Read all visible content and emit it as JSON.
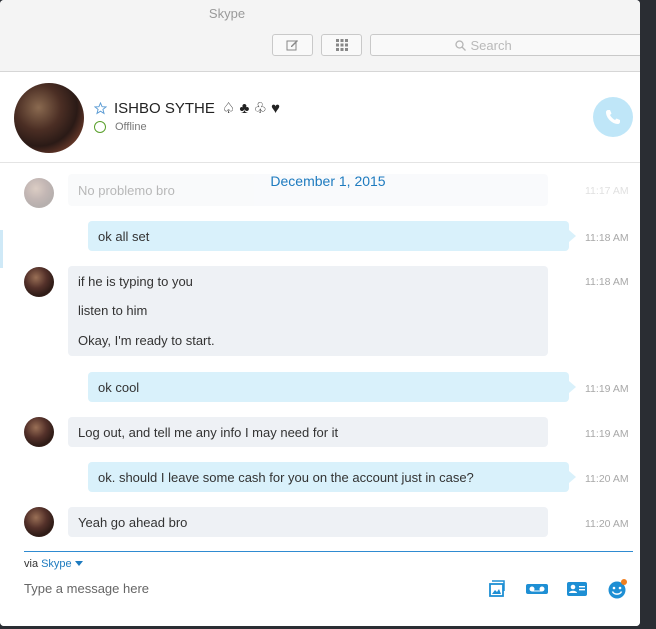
{
  "app": {
    "window_title": "Skype"
  },
  "toolbar": {
    "compose_icon": "compose-icon",
    "dialpad_icon": "dialpad-icon",
    "search_placeholder": "Search"
  },
  "contact": {
    "name": "ISHBO SYTHE",
    "suits": "♤ ♣ ♧ ♥",
    "status": "Offline",
    "colors": {
      "status": "#5aa02c",
      "call_button": "#bfe6f8"
    }
  },
  "conversation": {
    "date": "December 1, 2015",
    "messages": [
      {
        "direction": "in",
        "lines": [
          "No problemo bro"
        ],
        "time": "11:17 AM",
        "faded": true
      },
      {
        "direction": "out",
        "lines": [
          "ok all set"
        ],
        "time": "11:18 AM"
      },
      {
        "direction": "in",
        "lines": [
          "if he is typing to you",
          "listen to him",
          "Okay, I'm ready to start."
        ],
        "time": "11:18 AM"
      },
      {
        "direction": "out",
        "lines": [
          "ok cool"
        ],
        "time": "11:19 AM"
      },
      {
        "direction": "in",
        "lines": [
          "Log out, and tell me any info I may need for it"
        ],
        "time": "11:19 AM"
      },
      {
        "direction": "out",
        "lines": [
          "ok. should I leave some cash for you on the account just in case?"
        ],
        "time": "11:20 AM"
      },
      {
        "direction": "in",
        "lines": [
          "Yeah go ahead bro"
        ],
        "time": "11:20 AM"
      }
    ]
  },
  "composer": {
    "via_label": "via",
    "via_service": "Skype",
    "placeholder": "Type a message here",
    "tools": [
      "send-image-icon",
      "video-message-icon",
      "send-contact-icon",
      "emoticon-icon"
    ],
    "accent": "#1e7bbf"
  }
}
